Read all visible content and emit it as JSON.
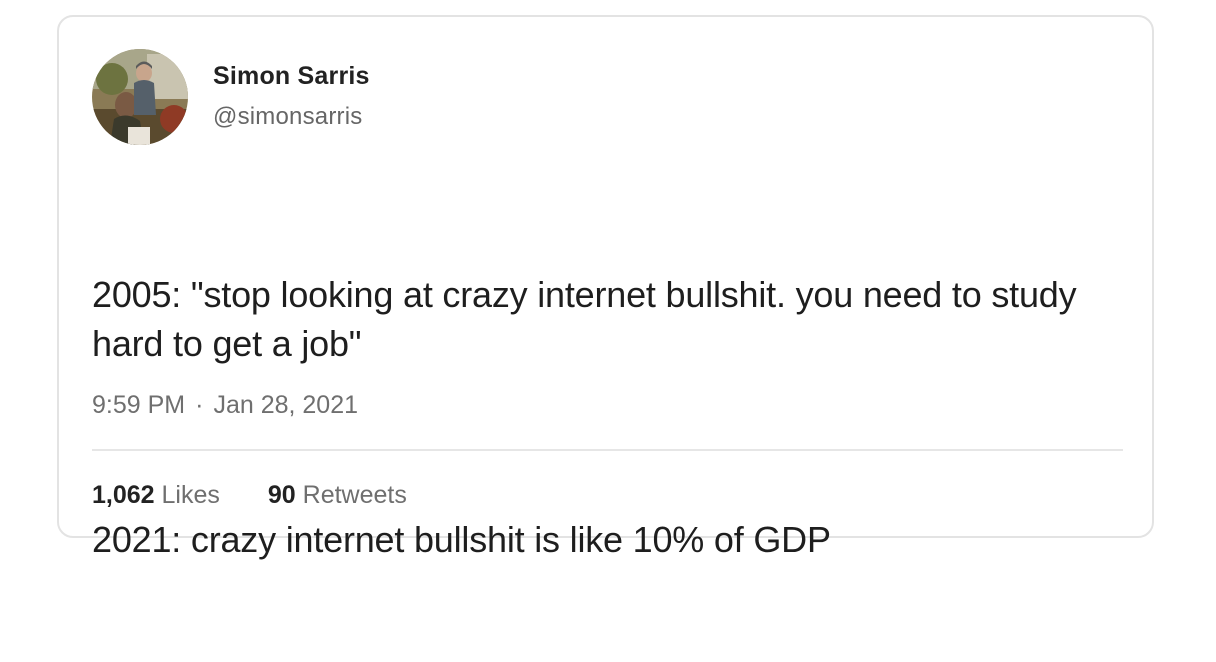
{
  "tweet": {
    "author": {
      "display_name": "Simon Sarris",
      "handle": "@simonsarris",
      "avatar_icon": "user-avatar-photo"
    },
    "paragraphs": [
      "2005: \"stop looking at crazy internet bullshit. you need to study hard to get a job\"",
      "2021: crazy internet bullshit is like 10% of GDP"
    ],
    "time": "9:59 PM",
    "separator": "·",
    "date": "Jan 28, 2021",
    "likes": {
      "count": "1,062",
      "label": "Likes"
    },
    "retweets": {
      "count": "90",
      "label": "Retweets"
    }
  },
  "colors": {
    "text": "#1e1e1e",
    "muted": "#6f6f6f",
    "border": "#e3e3e3"
  }
}
